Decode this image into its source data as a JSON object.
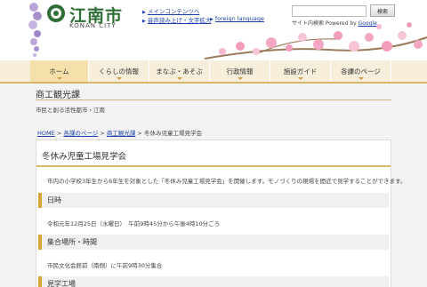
{
  "header": {
    "site_title": "江南市",
    "site_subtitle": "KONAN CITY",
    "links": [
      {
        "label": "メインコンテンツへ"
      },
      {
        "label": "音声読み上げ・文字拡大"
      },
      {
        "label": "foreign language"
      }
    ],
    "search": {
      "placeholder": "",
      "button": "検索",
      "powered_by": "サイト内検索 Powered by",
      "google": "Google"
    }
  },
  "nav": {
    "items": [
      {
        "label": "ホーム"
      },
      {
        "label": "くらしの情報"
      },
      {
        "label": "まなぶ・あそぶ"
      },
      {
        "label": "行政情報"
      },
      {
        "label": "施設ガイド"
      },
      {
        "label": "各課のページ"
      }
    ]
  },
  "department": {
    "title": "商工観光課",
    "subtitle": "市民と創る活性都市・江南"
  },
  "breadcrumb": {
    "items": [
      "HOME",
      "各課のページ",
      "商工観光課"
    ],
    "separator": ">",
    "current": "冬休み児童工場見学会"
  },
  "article": {
    "title": "冬休み児童工場見学会",
    "intro": "市内の小学校3年生から6年生を対象とした「冬休み児童工場見学会」を開催します。モノづくりの現場を間近で見学することができます。",
    "sections": [
      {
        "heading": "日時",
        "text": "令和元年12月25日（水曜日）　午前9時45分から午後4時10分ごろ"
      },
      {
        "heading": "集合場所・時間",
        "text": "市民文化会館前（南側）に午前9時30分集合"
      },
      {
        "heading": "見学工場",
        "text": ""
      }
    ]
  },
  "colors": {
    "accent": "#d8a23a",
    "link": "#1a3fa8",
    "brand_green": "#2f6f36"
  }
}
